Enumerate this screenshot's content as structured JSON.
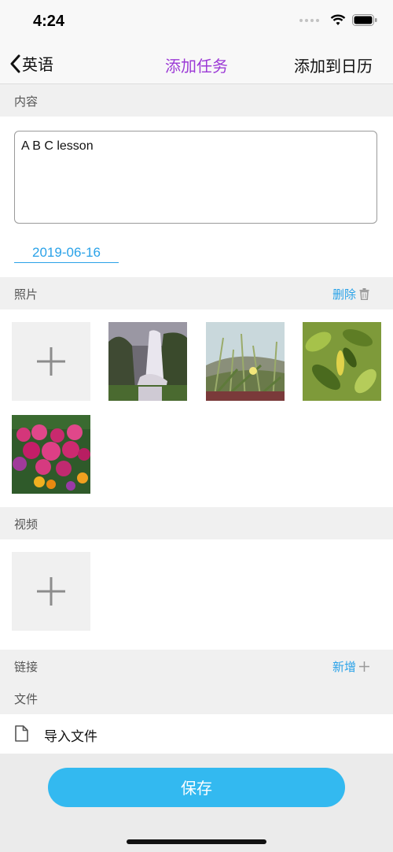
{
  "status": {
    "time": "4:24"
  },
  "nav": {
    "back_label": "英语",
    "title": "添加任务",
    "right_action": "添加到日历"
  },
  "content": {
    "header": "内容",
    "text": "A B C lesson",
    "date": "2019-06-16"
  },
  "photos": {
    "header": "照片",
    "delete_label": "删除",
    "items": [
      "waterfall",
      "grass-flower",
      "green-leaves",
      "pink-flowers"
    ]
  },
  "video": {
    "header": "视频"
  },
  "links": {
    "header": "链接",
    "add_label": "新增"
  },
  "files": {
    "header": "文件",
    "import_label": "导入文件"
  },
  "save_label": "保存",
  "colors": {
    "accent": "#2aa2e8",
    "title": "#9c3ad6",
    "save": "#33b9f0"
  }
}
